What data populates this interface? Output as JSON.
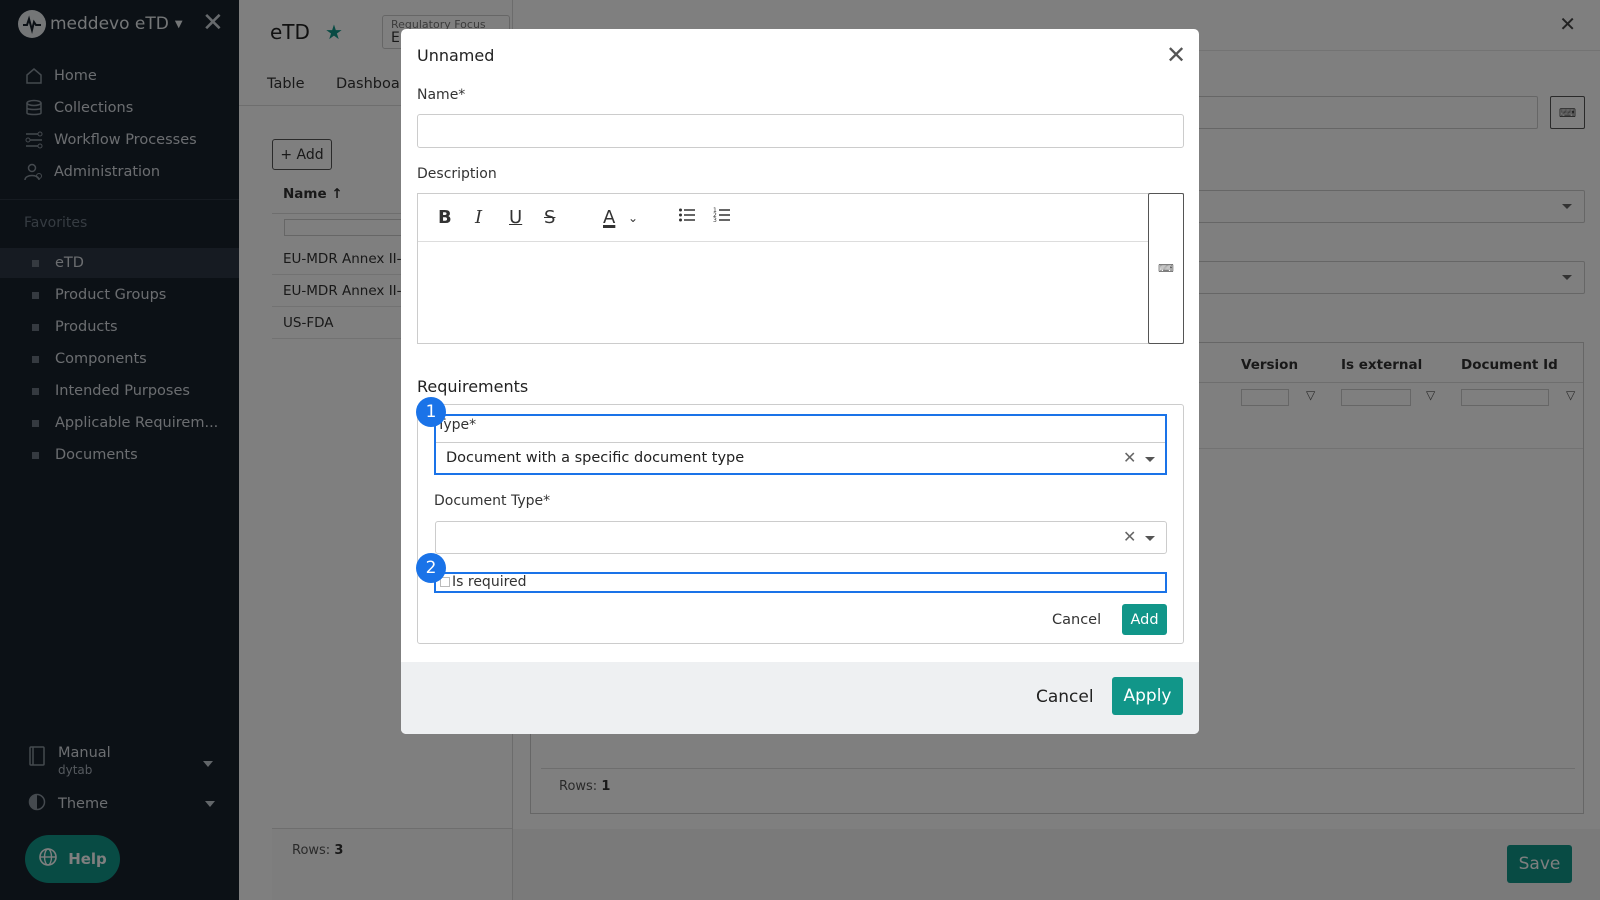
{
  "sidebar": {
    "brand": "meddevo eTD",
    "nav": [
      {
        "label": "Home",
        "icon": "home-icon"
      },
      {
        "label": "Collections",
        "icon": "database-icon"
      },
      {
        "label": "Workflow Processes",
        "icon": "workflow-icon"
      },
      {
        "label": "Administration",
        "icon": "admin-users-icon"
      }
    ],
    "favorites_title": "Favorites",
    "favorites": [
      {
        "label": "eTD",
        "active": true
      },
      {
        "label": "Product Groups",
        "active": false
      },
      {
        "label": "Products",
        "active": false
      },
      {
        "label": "Components",
        "active": false
      },
      {
        "label": "Intended Purposes",
        "active": false
      },
      {
        "label": "Applicable Requirem...",
        "active": false
      },
      {
        "label": "Documents",
        "active": false
      }
    ],
    "manual": {
      "title": "Manual",
      "sub": "dytab"
    },
    "theme": "Theme",
    "help": "Help"
  },
  "main": {
    "title": "eTD",
    "focus_label": "Regulatory Focus",
    "focus_value": "E",
    "tabs": [
      "Table",
      "Dashboar"
    ],
    "add_label": "+ Add",
    "col_name": "Name ↑",
    "rows": [
      "EU-MDR Annex II-II",
      "EU-MDR Annex II-II",
      "US-FDA"
    ],
    "rows_label": "Rows:",
    "rows_count": "3"
  },
  "panel": {
    "columns": [
      "Version",
      "Is external",
      "Document Id"
    ],
    "rows_label": "Rows:",
    "rows_count": "1",
    "save": "Save"
  },
  "modal": {
    "title": "Unnamed",
    "name_label": "Name*",
    "name_value": "",
    "description_label": "Description",
    "toolbar": [
      "B",
      "I",
      "U",
      "S",
      "A"
    ],
    "requirements_title": "Requirements",
    "type_label": "Type*",
    "type_value": "Document with a specific document type",
    "doc_type_label": "Document Type*",
    "doc_type_value": "",
    "is_required_label": "Is required",
    "is_required": false,
    "req_cancel": "Cancel",
    "req_add": "Add",
    "cancel": "Cancel",
    "apply": "Apply",
    "badges": [
      "1",
      "2"
    ]
  },
  "colors": {
    "accent": "#119689",
    "sidebar_bg": "#18222d",
    "highlight": "#1a73e8"
  }
}
